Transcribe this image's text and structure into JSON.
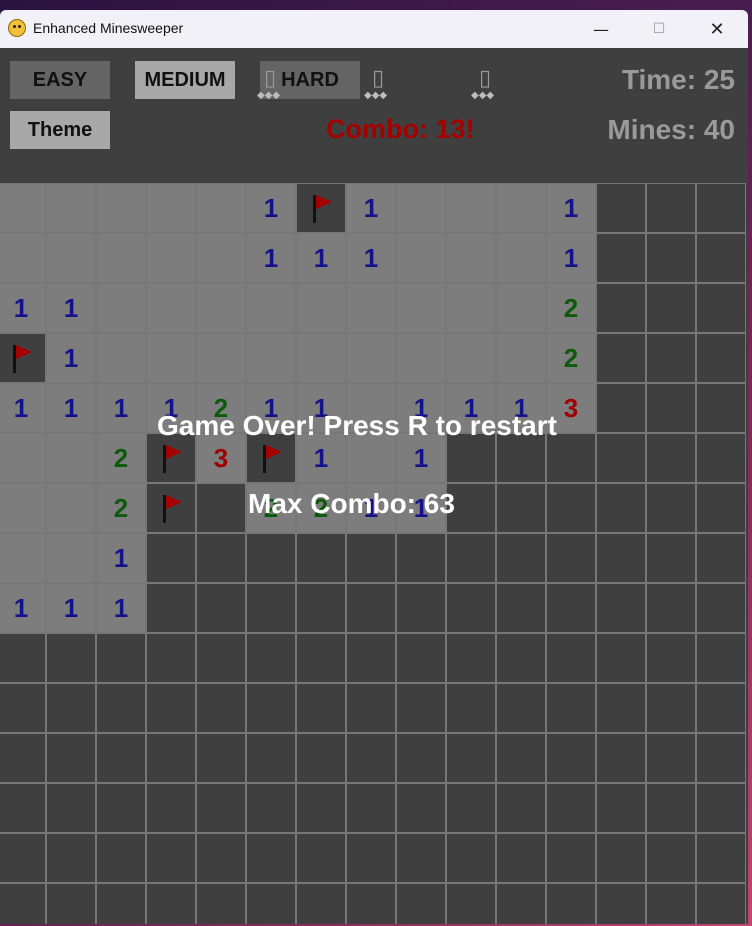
{
  "window": {
    "title": "Enhanced Minesweeper",
    "minimize": "—",
    "maximize": "☐",
    "close": "✕"
  },
  "toolbar": {
    "easy": "EASY",
    "medium": "MEDIUM",
    "hard": "HARD",
    "theme": "Theme",
    "glyph": "▯",
    "dots": "◆◆◆"
  },
  "status": {
    "time": "Time: 25",
    "mines": "Mines: 40",
    "combo": "Combo: 13!"
  },
  "overlay": {
    "game_over": "Game Over! Press R to restart",
    "max_combo": "Max Combo: 63"
  },
  "colors": {
    "number_1": "#13128a",
    "number_2": "#0d5a0d",
    "number_3": "#a00000",
    "flag": "#a40000",
    "combo": "#a50000"
  },
  "board": {
    "rows": [
      [
        "o",
        "o",
        "o",
        "o",
        "o",
        "1",
        "F",
        "1",
        "o",
        "o",
        "o",
        "1",
        "h",
        "h",
        "h"
      ],
      [
        "o",
        "o",
        "o",
        "o",
        "o",
        "1",
        "1",
        "1",
        "o",
        "o",
        "o",
        "1",
        "h",
        "h",
        "h"
      ],
      [
        "1",
        "1",
        "o",
        "o",
        "o",
        "o",
        "o",
        "o",
        "o",
        "o",
        "o",
        "2",
        "h",
        "h",
        "h"
      ],
      [
        "F",
        "1",
        "o",
        "o",
        "o",
        "o",
        "o",
        "o",
        "o",
        "o",
        "o",
        "2",
        "h",
        "h",
        "h"
      ],
      [
        "1",
        "1",
        "1",
        "1",
        "2",
        "1",
        "1",
        "o",
        "1",
        "1",
        "1",
        "3",
        "h",
        "h",
        "h"
      ],
      [
        "o",
        "o",
        "2",
        "F",
        "3",
        "F",
        "1",
        "o",
        "1",
        "h",
        "h",
        "h",
        "h",
        "h",
        "h"
      ],
      [
        "o",
        "o",
        "2",
        "F",
        "h",
        "2",
        "2",
        "1",
        "1",
        "h",
        "h",
        "h",
        "h",
        "h",
        "h"
      ],
      [
        "o",
        "o",
        "1",
        "h",
        "h",
        "h",
        "h",
        "h",
        "h",
        "h",
        "h",
        "h",
        "h",
        "h",
        "h"
      ],
      [
        "1",
        "1",
        "1",
        "h",
        "h",
        "h",
        "h",
        "h",
        "h",
        "h",
        "h",
        "h",
        "h",
        "h",
        "h"
      ],
      [
        "h",
        "h",
        "h",
        "h",
        "h",
        "h",
        "h",
        "h",
        "h",
        "h",
        "h",
        "h",
        "h",
        "h",
        "h"
      ],
      [
        "h",
        "h",
        "h",
        "h",
        "h",
        "h",
        "h",
        "h",
        "h",
        "h",
        "h",
        "h",
        "h",
        "h",
        "h"
      ],
      [
        "h",
        "h",
        "h",
        "h",
        "h",
        "h",
        "h",
        "h",
        "h",
        "h",
        "h",
        "h",
        "h",
        "h",
        "h"
      ],
      [
        "h",
        "h",
        "h",
        "h",
        "h",
        "h",
        "h",
        "h",
        "h",
        "h",
        "h",
        "h",
        "h",
        "h",
        "h"
      ],
      [
        "h",
        "h",
        "h",
        "h",
        "h",
        "h",
        "h",
        "h",
        "h",
        "h",
        "h",
        "h",
        "h",
        "h",
        "h"
      ],
      [
        "h",
        "h",
        "h",
        "h",
        "h",
        "h",
        "h",
        "h",
        "h",
        "h",
        "h",
        "h",
        "h",
        "h",
        "h"
      ]
    ]
  }
}
